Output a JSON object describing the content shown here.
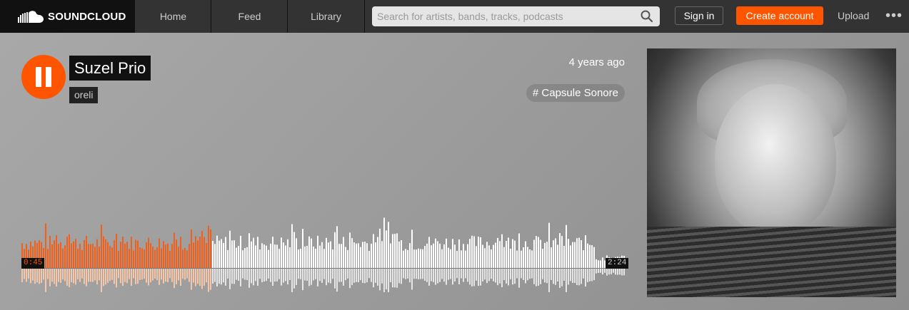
{
  "header": {
    "logo_text": "SOUNDCLOUD",
    "nav": [
      "Home",
      "Feed",
      "Library"
    ],
    "search_placeholder": "Search for artists, bands, tracks, podcasts",
    "sign_in": "Sign in",
    "create_account": "Create account",
    "upload": "Upload",
    "more": "•••"
  },
  "track": {
    "title": "Suzel Prio",
    "artist": "oreli",
    "posted": "4 years ago",
    "tag": "# Capsule Sonore",
    "current_time": "0:45",
    "duration": "2:24",
    "progress_fraction": 0.3125
  },
  "colors": {
    "accent": "#ff5500",
    "played": "#f0601a",
    "unplayed": "#ffffff"
  }
}
